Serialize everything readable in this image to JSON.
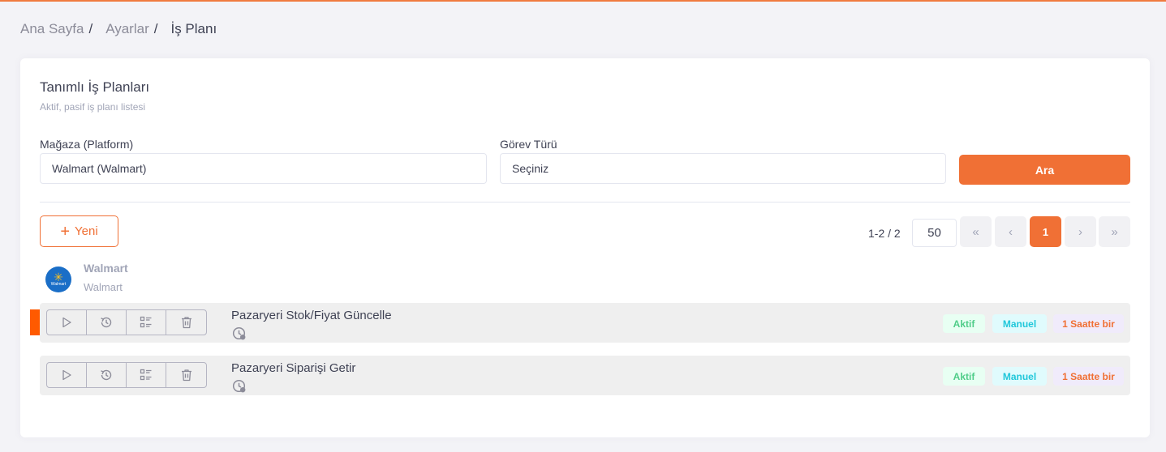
{
  "breadcrumb": {
    "home": "Ana Sayfa",
    "sep": "/",
    "settings": "Ayarlar",
    "current": "İş Planı"
  },
  "card": {
    "title": "Tanımlı İş Planları",
    "subtitle": "Aktif, pasif iş planı listesi"
  },
  "filters": {
    "store_label": "Mağaza (Platform)",
    "store_value": "Walmart (Walmart)",
    "task_type_label": "Görev Türü",
    "task_type_value": "Seçiniz",
    "search_label": "Ara"
  },
  "toolbar": {
    "new_plus": "+",
    "new_label": "Yeni"
  },
  "pager": {
    "info": "1-2 / 2",
    "page_size": "50",
    "first": "«",
    "prev": "‹",
    "current": "1",
    "next": "›",
    "last": "»"
  },
  "store": {
    "name": "Walmart",
    "platform": "Walmart",
    "logo_text": "Walmart",
    "logo_spark": "✳"
  },
  "tasks": [
    {
      "name": "Pazaryeri Stok/Fiyat Güncelle",
      "status": "Aktif",
      "mode": "Manuel",
      "period": "1 Saatte bir",
      "selected": true
    },
    {
      "name": "Pazaryeri Siparişi Getir",
      "status": "Aktif",
      "mode": "Manuel",
      "period": "1 Saatte bir",
      "selected": false
    }
  ],
  "icons": [
    "play-icon",
    "history-icon",
    "list-details-icon",
    "trash-icon",
    "clock-icon"
  ],
  "colors": {
    "accent": "#f07035",
    "active_badge": "#50cd89",
    "manual_badge": "#20c7da",
    "marker": "#ff5a00"
  }
}
